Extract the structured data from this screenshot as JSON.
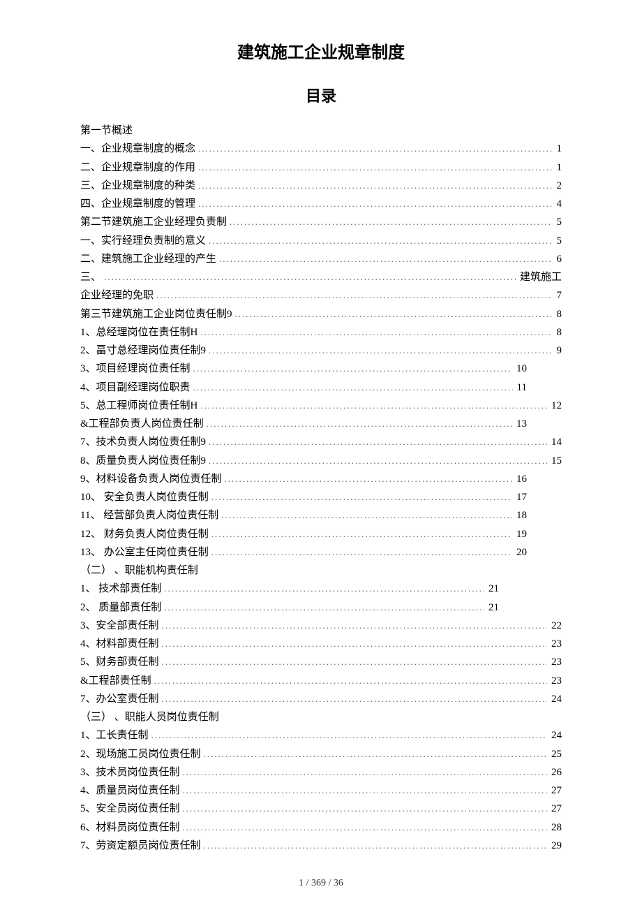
{
  "title": "建筑施工企业规章制度",
  "subtitle": "目录",
  "toc": [
    {
      "label": "第一节概述",
      "page": null,
      "indent": null
    },
    {
      "label": "一、企业规章制度的概念",
      "page": "1",
      "indent": null
    },
    {
      "label": "二、企业规章制度的作用",
      "page": "1",
      "indent": null
    },
    {
      "label": "三、企业规章制度的种类",
      "page": "2",
      "indent": null
    },
    {
      "label": "四、企业规章制度的管理",
      "page": "4",
      "indent": null
    },
    {
      "label": "第二节建筑施工企业经理负责制",
      "page": "5",
      "indent": null
    },
    {
      "label": "一、实行经理负责制的意义",
      "page": "5",
      "indent": null
    },
    {
      "label": "二、建筑施工企业经理的产生",
      "page": "6",
      "indent": null
    },
    {
      "label": "三、",
      "page": "建筑施工",
      "indent": null
    },
    {
      "label": "企业经理的免职",
      "page": "7",
      "indent": null
    },
    {
      "label": "第三节建筑施工企业岗位责任制9",
      "page": "8",
      "indent": null
    },
    {
      "label": "1、总经理岗位在责任制H",
      "page": "8",
      "indent": null
    },
    {
      "label": "2、畐寸总经理岗位责任制9",
      "page": "9",
      "indent": null
    },
    {
      "label": "3、项目经理岗位责任制",
      "page": "10",
      "indent": 1
    },
    {
      "label": "4、项目副经理岗位职责",
      "page": "11",
      "indent": 1
    },
    {
      "label": "5、总工程师岗位责任制H",
      "page": "12",
      "indent": null
    },
    {
      "label": "&工程部负责人岗位责任制",
      "page": "13",
      "indent": 1
    },
    {
      "label": "7、技术负责人岗位责任制9",
      "page": "14",
      "indent": null
    },
    {
      "label": "8、质量负责人岗位责任制9",
      "page": "15",
      "indent": null
    },
    {
      "label": "9、材料设备负责人岗位责任制",
      "page": "16",
      "indent": 1
    },
    {
      "label": "10、  安全负责人岗位责任制",
      "page": "17",
      "indent": 1
    },
    {
      "label": "11、  经营部负责人岗位责任制",
      "page": "18",
      "indent": 1
    },
    {
      "label": "12、  财务负责人岗位责任制",
      "page": "19",
      "indent": 1
    },
    {
      "label": "13、  办公室主任岗位责任制",
      "page": "20",
      "indent": 1
    },
    {
      "label": "（二）  、职能机构责任制",
      "page": null,
      "indent": null
    },
    {
      "label": "1、  技术部责任制",
      "page": "21",
      "indent": 2
    },
    {
      "label": "2、  质量部责任制",
      "page": "21",
      "indent": 2
    },
    {
      "label": "3、安全部责任制",
      "page": "22",
      "indent": null
    },
    {
      "label": "4、材料部责任制",
      "page": "23",
      "indent": null
    },
    {
      "label": "5、财务部责任制",
      "page": "23",
      "indent": null
    },
    {
      "label": "&工程部责任制",
      "page": "23",
      "indent": null
    },
    {
      "label": "7、办公室责任制",
      "page": "24",
      "indent": null
    },
    {
      "label": "（三）  、职能人员岗位责任制",
      "page": null,
      "indent": null
    },
    {
      "label": "1、工长责任制",
      "page": "24",
      "indent": null
    },
    {
      "label": "2、现场施工员岗位责任制",
      "page": "25",
      "indent": null
    },
    {
      "label": "3、技术员岗位责任制",
      "page": "26",
      "indent": null
    },
    {
      "label": "4、质量员岗位责任制",
      "page": "27",
      "indent": null
    },
    {
      "label": "5、安全员岗位责任制",
      "page": "27",
      "indent": null
    },
    {
      "label": "6、材料员岗位责任制",
      "page": "28",
      "indent": null
    },
    {
      "label": "7、劳资定额员岗位责任制",
      "page": "29",
      "indent": null
    }
  ],
  "footer": "1 / 369 / 36"
}
